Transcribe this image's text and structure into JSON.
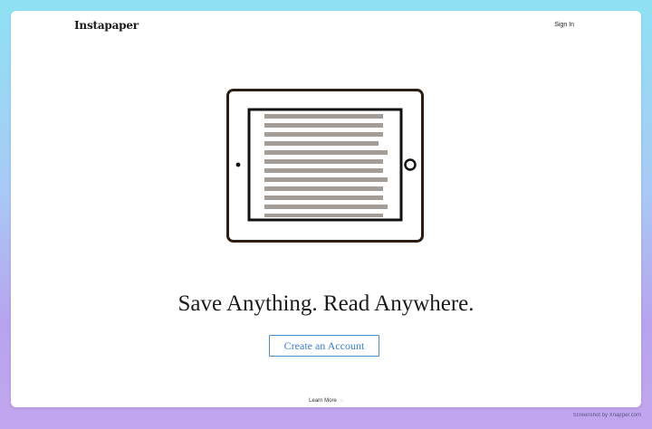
{
  "header": {
    "logo": "Instapaper",
    "signin_label": "Sign In"
  },
  "hero": {
    "illustration": "tablet-with-article",
    "headline": "Save Anything. Read Anywhere.",
    "cta_label": "Create an Account"
  },
  "footer": {
    "learn_more_label": "Learn More",
    "learn_more_icon": "chevron-down-icon"
  },
  "watermark": "Screenshot by Xnapper.com",
  "colors": {
    "accent": "#3a7fc1",
    "text_lines": "#a39c97",
    "tablet_stroke": "#2b1d12"
  }
}
